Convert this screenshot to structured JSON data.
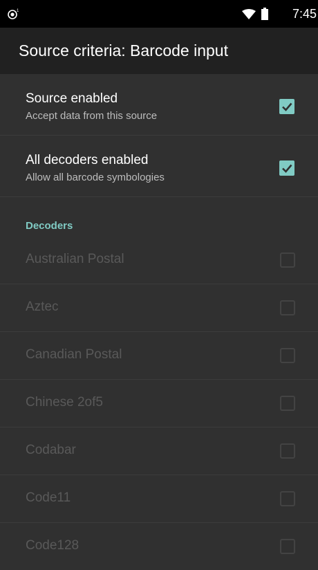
{
  "status_bar": {
    "time": "7:45",
    "left_icon": "notification-dot-icon",
    "wifi_icon": "wifi-icon",
    "battery_icon": "battery-icon"
  },
  "app_bar": {
    "title": "Source criteria: Barcode input"
  },
  "preferences": [
    {
      "title": "Source enabled",
      "summary": "Accept data from this source",
      "checked": true
    },
    {
      "title": "All decoders enabled",
      "summary": "Allow all barcode symbologies",
      "checked": true
    }
  ],
  "decoders_section": {
    "header": "Decoders",
    "items": [
      {
        "label": "Australian Postal",
        "checked": false,
        "enabled": false
      },
      {
        "label": "Aztec",
        "checked": false,
        "enabled": false
      },
      {
        "label": "Canadian Postal",
        "checked": false,
        "enabled": false
      },
      {
        "label": "Chinese 2of5",
        "checked": false,
        "enabled": false
      },
      {
        "label": "Codabar",
        "checked": false,
        "enabled": false
      },
      {
        "label": "Code11",
        "checked": false,
        "enabled": false
      },
      {
        "label": "Code128",
        "checked": false,
        "enabled": false
      }
    ]
  },
  "colors": {
    "accent": "#80cbc4",
    "background": "#303030",
    "app_bar": "#212121",
    "status_bar": "#000000",
    "disabled_text": "#595959"
  }
}
